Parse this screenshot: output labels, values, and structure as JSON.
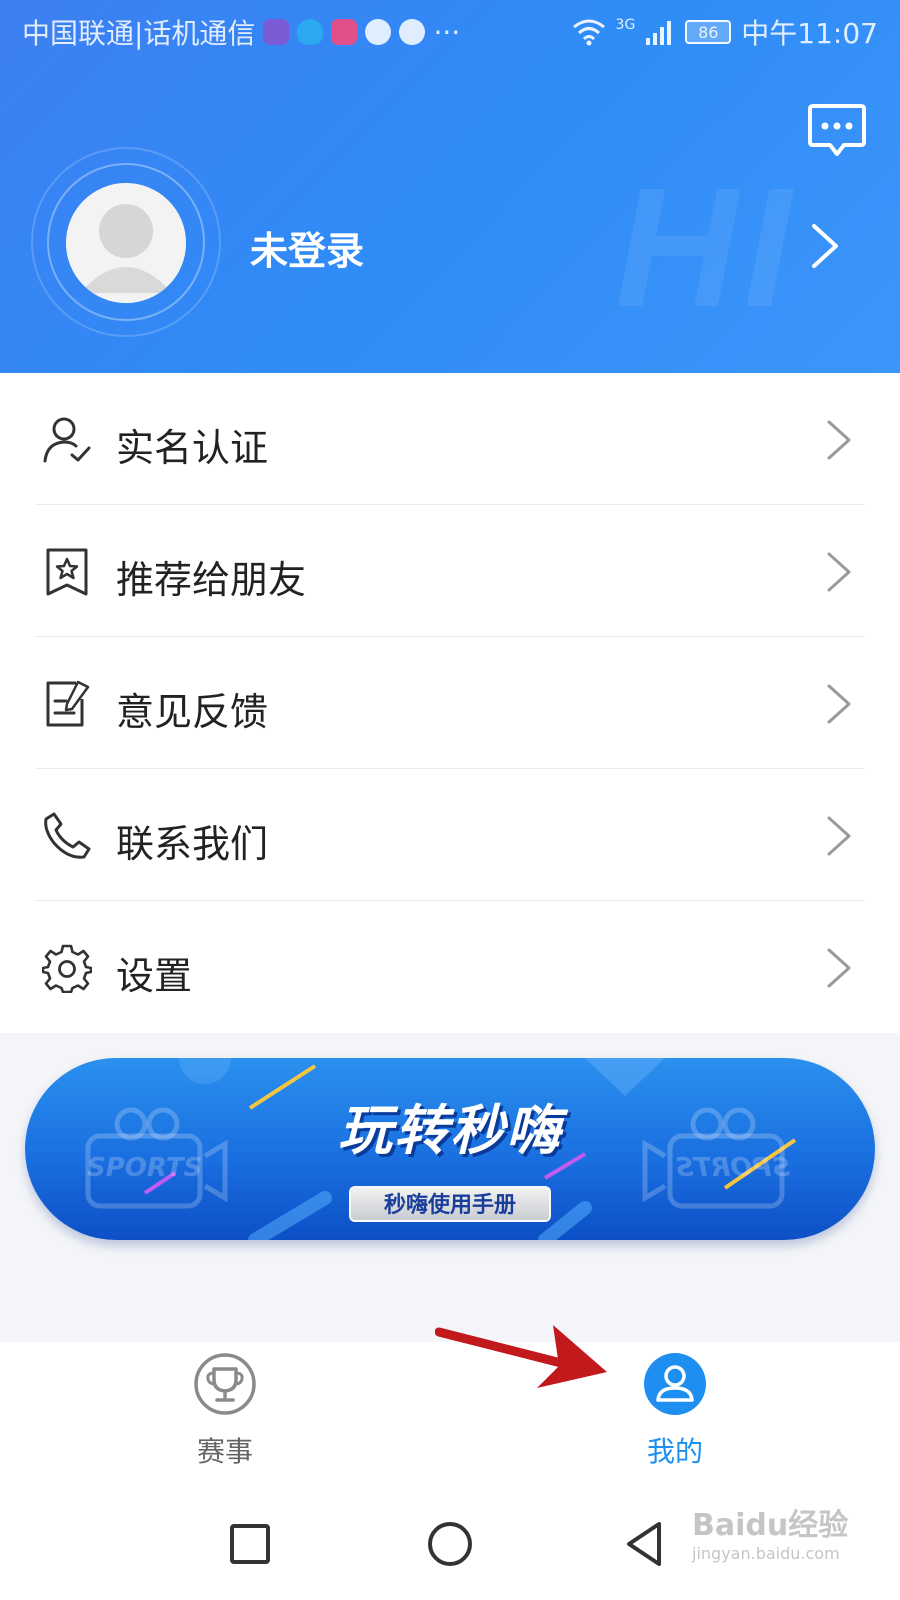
{
  "status_bar": {
    "carrier": "中国联通|话机通信",
    "more": "···",
    "network": "3G",
    "battery": "86",
    "time": "中午11:07"
  },
  "profile": {
    "login_status": "未登录",
    "bg_text": "HI"
  },
  "menu": {
    "items": [
      {
        "label": "实名认证",
        "icon": "user-check-icon"
      },
      {
        "label": "推荐给朋友",
        "icon": "recommend-star-icon"
      },
      {
        "label": "意见反馈",
        "icon": "feedback-edit-icon"
      },
      {
        "label": "联系我们",
        "icon": "phone-icon"
      },
      {
        "label": "设置",
        "icon": "gear-icon"
      }
    ]
  },
  "banner": {
    "title": "玩转秒嗨",
    "button_label": "秒嗨使用手册",
    "deco_text": "SPORTS"
  },
  "tabbar": {
    "tabs": [
      {
        "label": "赛事",
        "icon": "trophy-icon",
        "active": false
      },
      {
        "label": "我的",
        "icon": "user-icon",
        "active": true
      }
    ]
  },
  "watermark": {
    "brand": "Baidu经验",
    "url": "jingyan.baidu.com"
  },
  "colors": {
    "header_blue": "#3a8af6",
    "active_tab": "#1e8ff0",
    "inactive_tab": "#666666",
    "annotation_arrow": "#c2191c"
  }
}
